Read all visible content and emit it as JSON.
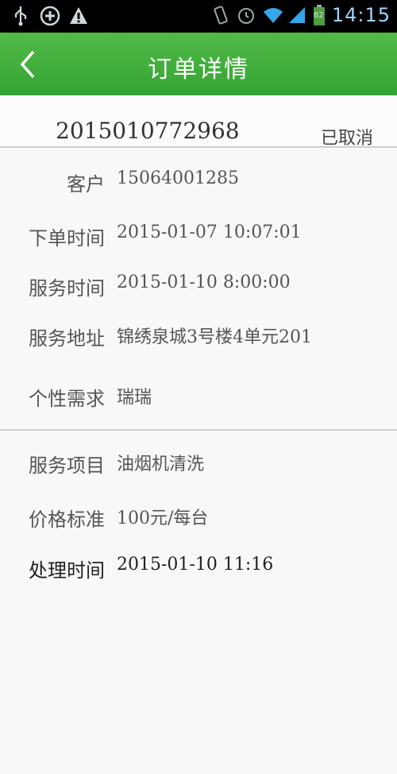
{
  "status_bar": {
    "time": "14:15",
    "battery": "82"
  },
  "header": {
    "title": "订单详情"
  },
  "order": {
    "number": "2015010772968",
    "status": "已取消"
  },
  "details": [
    {
      "label": "客户",
      "value": "15064001285"
    },
    {
      "label": "下单时间",
      "value": "2015-01-07 10:07:01"
    },
    {
      "label": "服务时间",
      "value": "2015-01-10 8:00:00"
    },
    {
      "label": "服务地址",
      "value": "锦绣泉城3号楼4单元201"
    },
    {
      "label": "个性需求",
      "value": "瑞瑞"
    }
  ],
  "service": [
    {
      "label": "服务项目",
      "value": "油烟机清洗"
    },
    {
      "label": "价格标准",
      "value": "100元/每台"
    },
    {
      "label": "处理时间",
      "value": "2015-01-10 11:16"
    }
  ]
}
